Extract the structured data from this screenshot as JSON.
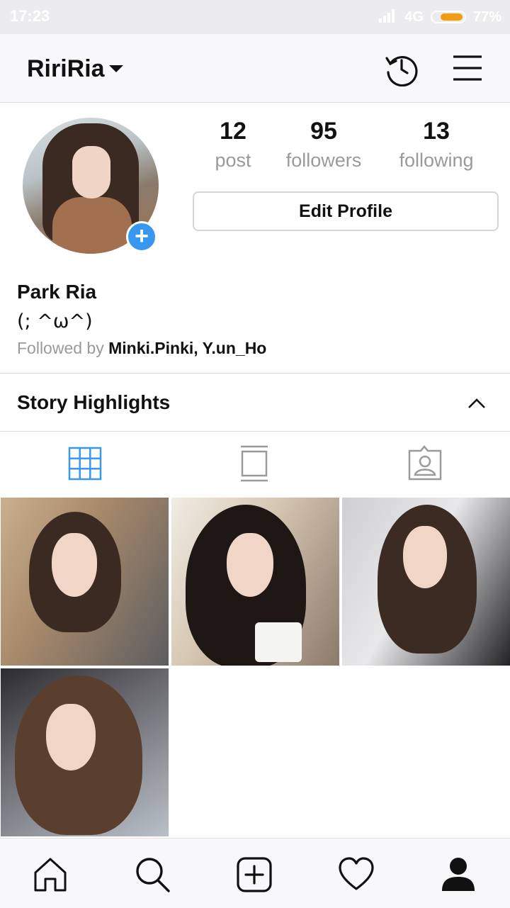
{
  "status_bar": {
    "time": "17:23",
    "network": "4G",
    "battery": "77%"
  },
  "header": {
    "username": "RiriRia"
  },
  "profile": {
    "stats": [
      {
        "value": "12",
        "label": "post"
      },
      {
        "value": "95",
        "label": "followers"
      },
      {
        "value": "13",
        "label": "following"
      }
    ],
    "edit_profile_label": "Edit Profile",
    "full_name": "Park Ria",
    "bio": "(; ^ω^)",
    "followed_by_prefix": "Followed by ",
    "followed_by_names": "Minki.Pinki, Y.un_Ho"
  },
  "highlights": {
    "title": "Story Highlights"
  },
  "colors": {
    "accent": "#3897f0",
    "muted": "#9a9a9a",
    "battery": "#f39c12"
  },
  "icons": {
    "header": [
      "history-icon",
      "menu-icon"
    ],
    "tabs": [
      "grid-icon",
      "feed-icon",
      "tagged-icon"
    ],
    "nav": [
      "home-icon",
      "search-icon",
      "add-icon",
      "heart-icon",
      "profile-icon"
    ]
  }
}
